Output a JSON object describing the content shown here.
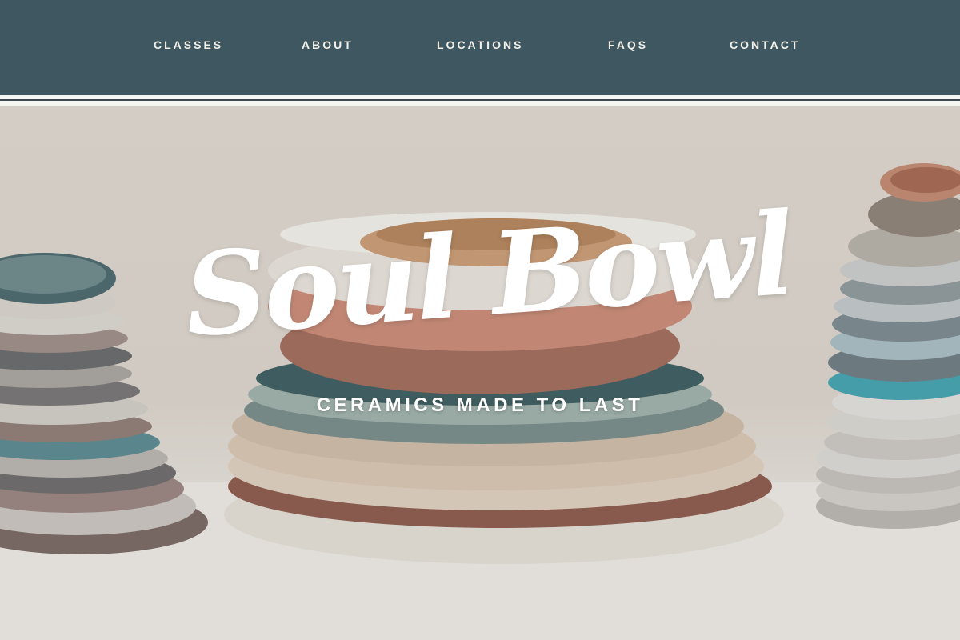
{
  "nav": {
    "items": [
      {
        "label": "CLASSES"
      },
      {
        "label": "ABOUT"
      },
      {
        "label": "LOCATIONS"
      },
      {
        "label": "FAQS"
      },
      {
        "label": "CONTACT"
      }
    ]
  },
  "hero": {
    "brand": "Soul Bowl",
    "tagline": "CERAMICS MADE TO LAST",
    "image_alt": "stacks of handmade ceramic plates and bowls"
  },
  "colors": {
    "nav_background": "#3e5760",
    "nav_text": "#f4f1ea",
    "hero_text": "#ffffff"
  }
}
